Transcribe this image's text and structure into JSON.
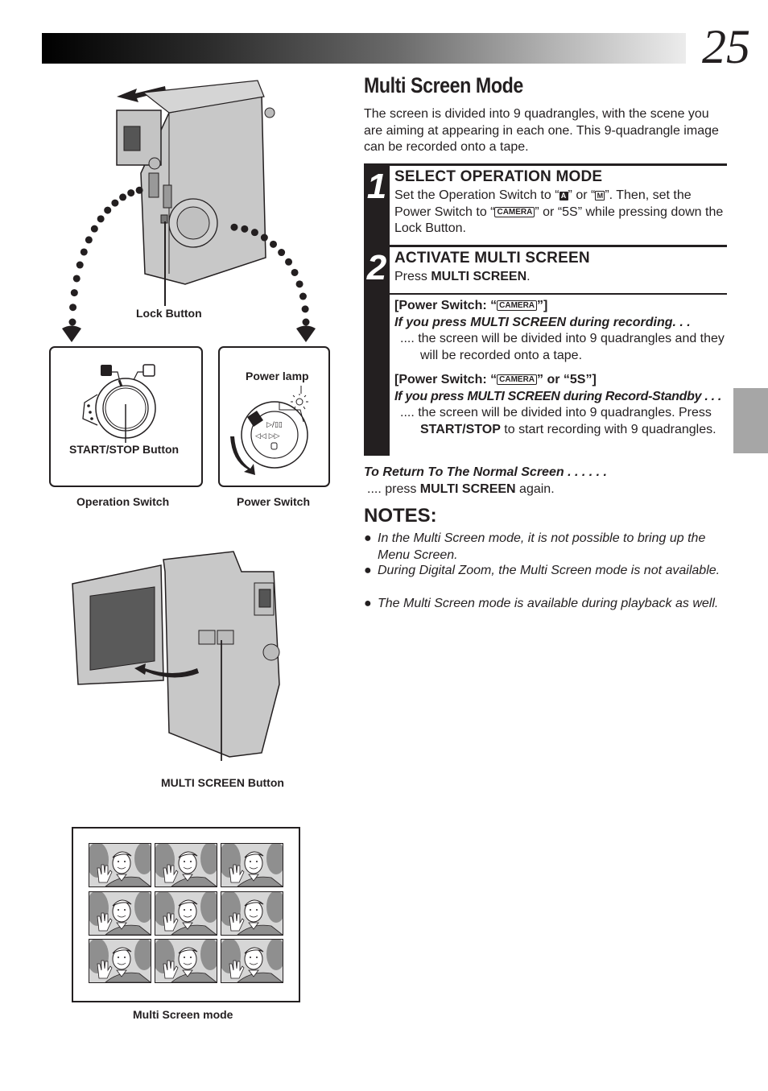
{
  "page": {
    "number": "25",
    "title": "Multi Screen Mode",
    "intro": "The screen is divided into 9 quadrangles, with the scene you are aiming at appearing in each one. This 9-quadrangle image can be recorded onto a tape."
  },
  "steps": [
    {
      "number": "1",
      "heading": "SELECT OPERATION MODE",
      "text_parts": {
        "a": "Set the Operation Switch to “",
        "badge_a": "A",
        "b": "” or “",
        "badge_m": "M",
        "c": "”. Then, set the Power Switch to “",
        "badge_camera": "CAMERA",
        "d": "” or “5S” while pressing down the Lock Button."
      }
    },
    {
      "number": "2",
      "heading": "ACTIVATE MULTI SCREEN",
      "press_prefix": "Press ",
      "press_bold": "MULTI SCREEN",
      "press_suffix": "."
    }
  ],
  "cases": [
    {
      "condition_prefix": "[Power Switch: “",
      "badge": "CAMERA",
      "condition_suffix": "”]",
      "trigger": "If you press MULTI SCREEN during recording. . .",
      "result": ".... the screen will be divided into 9 quadrangles and they will be recorded onto a tape."
    },
    {
      "condition_prefix": "[Power Switch: “",
      "badge": "CAMERA",
      "condition_suffix": "” or “5S”]",
      "trigger": "If you press MULTI SCREEN during Record-Standby . . .",
      "result_a": ".... the screen will be divided into 9 quadrangles. Press ",
      "result_bold": "START/STOP",
      "result_b": " to start recording with 9 quadrangles."
    }
  ],
  "return": {
    "heading": "To Return To The Normal Screen . . . . . .",
    "prefix": ".... press ",
    "bold": "MULTI SCREEN",
    "suffix": " again."
  },
  "notes": {
    "title": "NOTES:",
    "items": [
      "In the Multi Screen mode, it is not possible to bring up the Menu Screen.",
      "During Digital Zoom, the Multi Screen mode is not available.",
      "The Multi Screen mode is available during playback as well."
    ],
    "bullet": "●"
  },
  "figures": {
    "lock_button": "Lock Button",
    "start_stop_button": "START/STOP Button",
    "power_lamp": "Power lamp",
    "operation_switch": "Operation Switch",
    "power_switch": "Power Switch",
    "multi_screen_button": "MULTI SCREEN Button",
    "multi_screen_mode": "Multi Screen mode"
  },
  "colors": {
    "ink": "#231f20",
    "side_tab": "#a6a6a6",
    "device_gray": "#c8c8c8"
  }
}
